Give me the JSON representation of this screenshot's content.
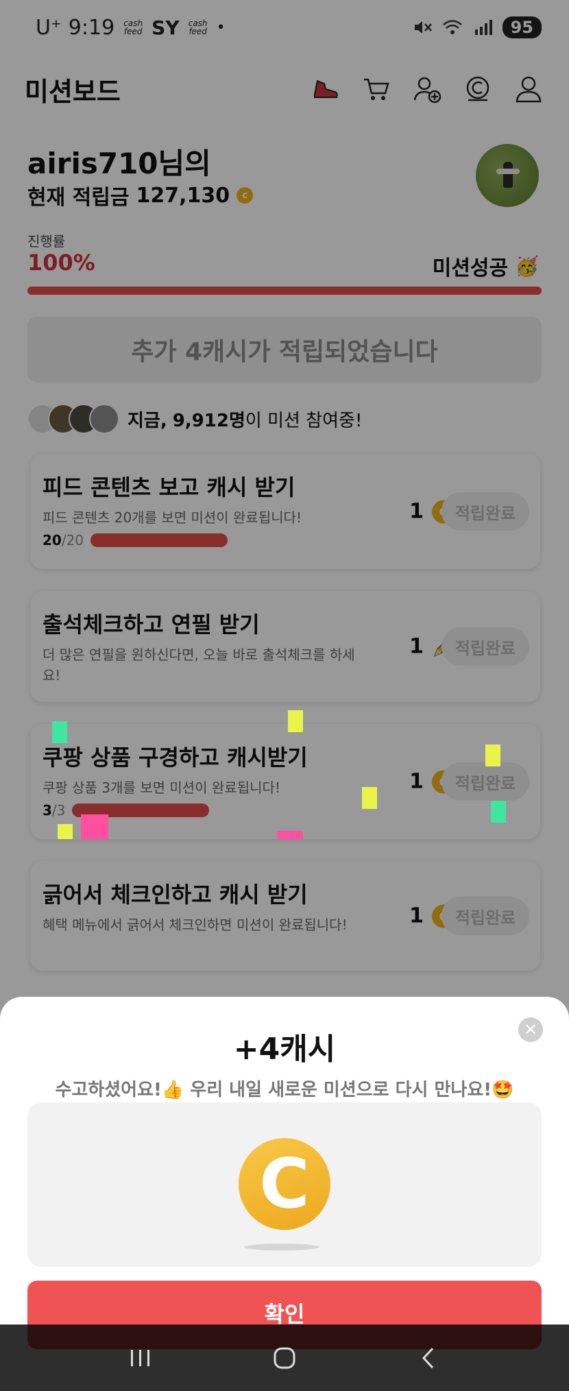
{
  "status_bar": {
    "carrier": "U⁺",
    "time": "9:19",
    "app_1": "cash feed",
    "app_2": "SY",
    "app_3": "cash feed",
    "dot": "•",
    "battery": "95"
  },
  "header": {
    "title": "미션보드",
    "icons": [
      "shoe-icon",
      "cart-icon",
      "add-friend-icon",
      "cash-icon",
      "profile-icon"
    ]
  },
  "profile": {
    "name": "airis710님의",
    "balance_label": "현재 적립금",
    "balance": "127,130"
  },
  "progress": {
    "label": "진행률",
    "value": "100%",
    "fraction": 1.0,
    "success_label": "미션성공",
    "success_emoji": "🥳"
  },
  "extra_banner": "추가 4캐시가 적립되었습니다",
  "participants": {
    "prefix": "지금,",
    "count": "9,912명",
    "suffix": "이 미션 참여중!"
  },
  "missions": [
    {
      "title": "피드 콘텐츠 보고 캐시 받기",
      "desc": "피드 콘텐츠 20개를 보면 미션이 완료됩니다!",
      "done": "20",
      "total": "/20",
      "reward": "1",
      "reward_icon": "coin-icon",
      "button": "적립완료"
    },
    {
      "title": "출석체크하고 연필 받기",
      "desc": "더 많은 연필을 원하신다면, 오늘 바로 출석체크를 하세요!",
      "reward": "1",
      "reward_icon": "pencil-icon",
      "button": "적립완료"
    },
    {
      "title": "쿠팡 상품 구경하고 캐시받기",
      "desc": "쿠팡 상품 3개를 보면 미션이 완료됩니다!",
      "done": "3",
      "total": "/3",
      "reward": "1",
      "reward_icon": "coin-icon",
      "button": "적립완료"
    },
    {
      "title": "긁어서 체크인하고 캐시 받기",
      "desc": "혜택 메뉴에서 긁어서 체크인하면 미션이 완료됩니다!",
      "reward": "1",
      "reward_icon": "coin-icon",
      "button": "적립완료"
    }
  ],
  "sheet": {
    "title": "+4캐시",
    "subtitle": "수고하셨어요!👍 우리 내일 새로운 미션으로 다시 만나요!🤩",
    "coin_letter": "C",
    "confirm": "확인",
    "close": "✕"
  },
  "colors": {
    "accent": "#f05353",
    "progress": "#e64b4b",
    "coin": "#f2b51a"
  }
}
